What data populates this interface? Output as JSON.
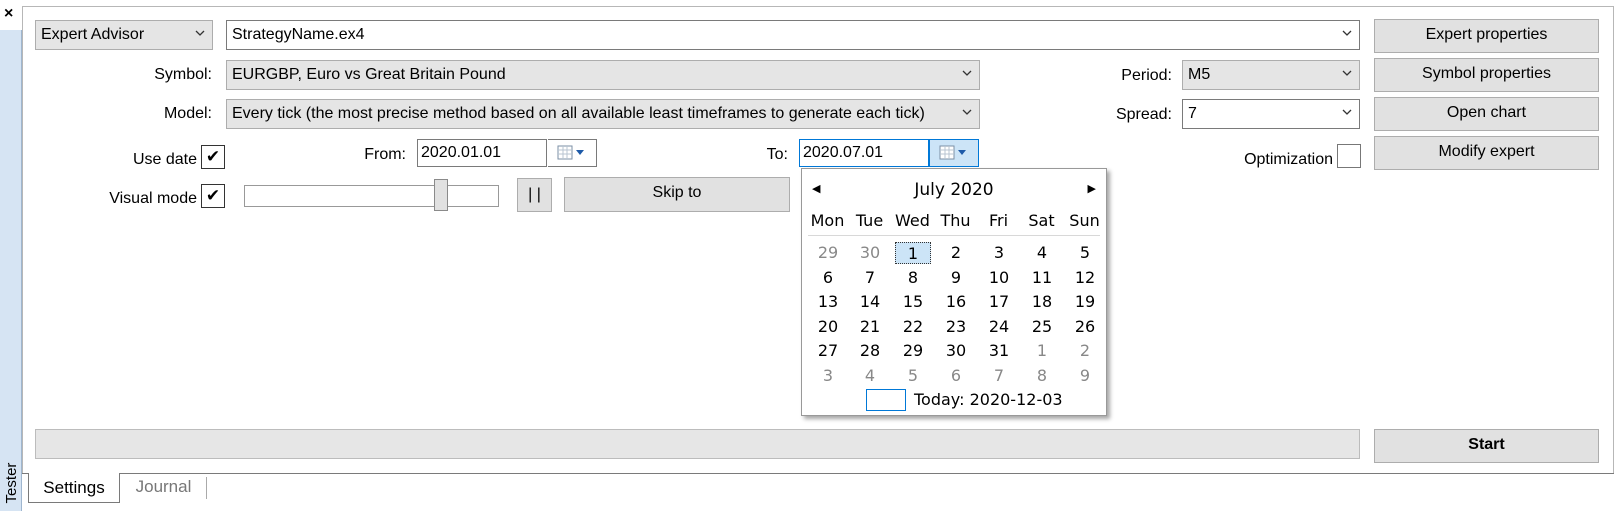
{
  "side_panel": {
    "close_glyph": "×",
    "label": "Tester"
  },
  "expert": {
    "type_value": "Expert Advisor",
    "file_value": "StrategyName.ex4"
  },
  "symbol": {
    "label": "Symbol:",
    "value": "EURGBP, Euro vs Great Britain Pound"
  },
  "model": {
    "label": "Model:",
    "value": "Every tick (the most precise method based on all available least timeframes to generate each tick)"
  },
  "period": {
    "label": "Period:",
    "value": "M5"
  },
  "spread": {
    "label": "Spread:",
    "value": "7"
  },
  "use_date": {
    "label": "Use date",
    "checked": true,
    "check_glyph": "✔"
  },
  "visual_mode": {
    "label": "Visual mode",
    "checked": true,
    "check_glyph": "✔",
    "speed_level_fraction": 0.79
  },
  "optimization": {
    "label": "Optimization",
    "checked": false
  },
  "from": {
    "label": "From:",
    "value": "2020.01.01"
  },
  "to": {
    "label": "To:",
    "value": "2020.07.01"
  },
  "buttons": {
    "expert_properties": "Expert properties",
    "symbol_properties": "Symbol properties",
    "open_chart": "Open chart",
    "modify_expert": "Modify expert",
    "pause": "| |",
    "skip_to": "Skip to",
    "start": "Start"
  },
  "calendar": {
    "month_title": "July 2020",
    "prev_glyph": "◀",
    "next_glyph": "▶",
    "weekdays": [
      "Mon",
      "Tue",
      "Wed",
      "Thu",
      "Fri",
      "Sat",
      "Sun"
    ],
    "weeks": [
      [
        "29",
        "30",
        "1",
        "2",
        "3",
        "4",
        "5"
      ],
      [
        "6",
        "7",
        "8",
        "9",
        "10",
        "11",
        "12"
      ],
      [
        "13",
        "14",
        "15",
        "16",
        "17",
        "18",
        "19"
      ],
      [
        "20",
        "21",
        "22",
        "23",
        "24",
        "25",
        "26"
      ],
      [
        "27",
        "28",
        "29",
        "30",
        "31",
        "1",
        "2"
      ],
      [
        "3",
        "4",
        "5",
        "6",
        "7",
        "8",
        "9"
      ]
    ],
    "selected_day": "1",
    "today_label": "Today: 2020-12-03"
  },
  "tabs": {
    "settings": "Settings",
    "journal": "Journal",
    "active": "Settings"
  },
  "colors": {
    "accent": "#0078d7",
    "selection": "#cce4f7",
    "side_panel": "#d6e4f3"
  }
}
